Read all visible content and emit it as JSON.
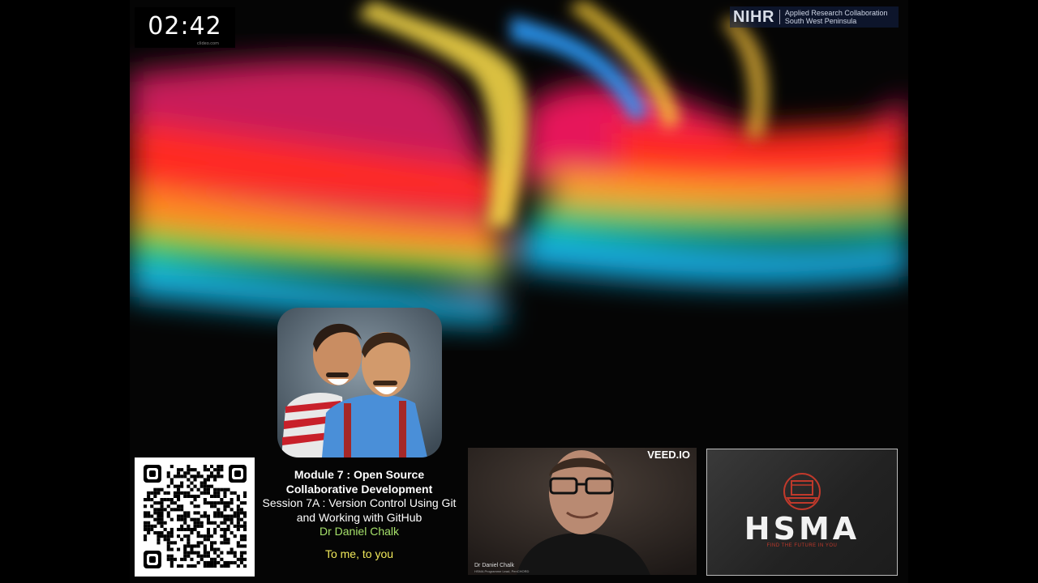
{
  "timer": {
    "value": "02:42",
    "credit": "clideo.com"
  },
  "nihr": {
    "mark": "NIHR",
    "line1": "Applied Research Collaboration",
    "line2": "South West Peninsula"
  },
  "caption": {
    "module": "Module 7 : Open Source Collaborative Development",
    "session": "Session 7A : Version Control Using Git and Working with GitHub",
    "author": "Dr Daniel Chalk",
    "subtitle": "To me, to you"
  },
  "video": {
    "brand": "VEED.IO",
    "name": "Dr Daniel Chalk",
    "role": "HSMA Programme Lead, PenCHORD"
  },
  "hsma": {
    "word": "HSMA",
    "tagline": "FIND THE FUTURE IN YOU"
  },
  "colors": {
    "author": "#a5e06a",
    "subtitle": "#f0e85a",
    "hsma_red": "#c0392b"
  }
}
